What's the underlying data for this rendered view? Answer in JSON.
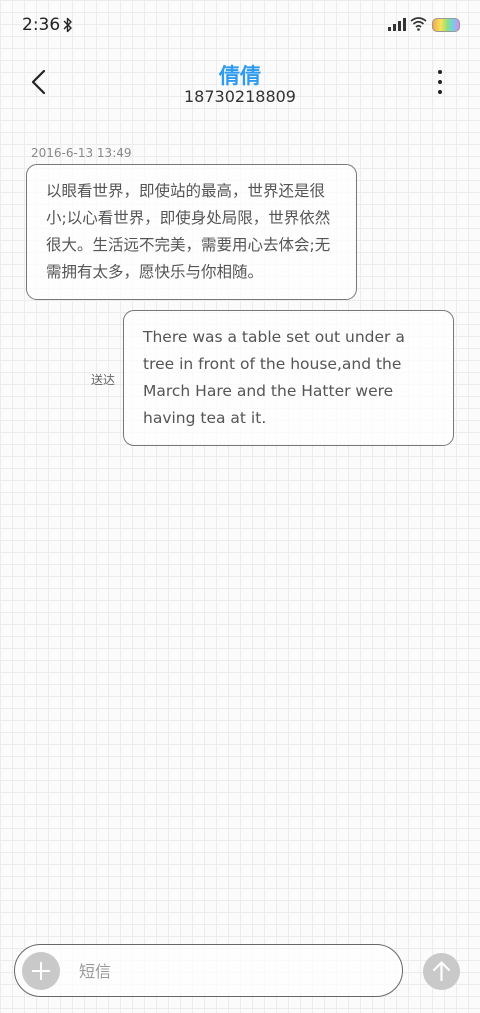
{
  "status_bar": {
    "time": "2:36",
    "icons": [
      "bluetooth-icon",
      "signal-icon",
      "wifi-icon",
      "battery-icon"
    ]
  },
  "header": {
    "contact_name": "倩倩",
    "phone_number": "18730218809",
    "back_icon": "chevron-left-icon",
    "menu_icon": "more-vertical-icon"
  },
  "conversation": {
    "timestamp": "2016-6-13 13:49",
    "messages": [
      {
        "direction": "incoming",
        "text": "以眼看世界，即使站的最高，世界还是很小;以心看世界，即使身处局限，世界依然很大。生活远不完美，需要用心去体会;无需拥有太多，愿快乐与你相随。"
      },
      {
        "direction": "outgoing",
        "status": "送达",
        "text": "There was a table set out under a tree in front of the house,and the March Hare and the Hatter were having tea at it."
      }
    ]
  },
  "compose": {
    "placeholder": "短信",
    "value": "",
    "add_icon": "plus-icon",
    "send_icon": "arrow-up-icon"
  },
  "colors": {
    "accent": "#2e9bf0",
    "bubble_border": "#777777",
    "button_gray": "#c9c9c9"
  }
}
